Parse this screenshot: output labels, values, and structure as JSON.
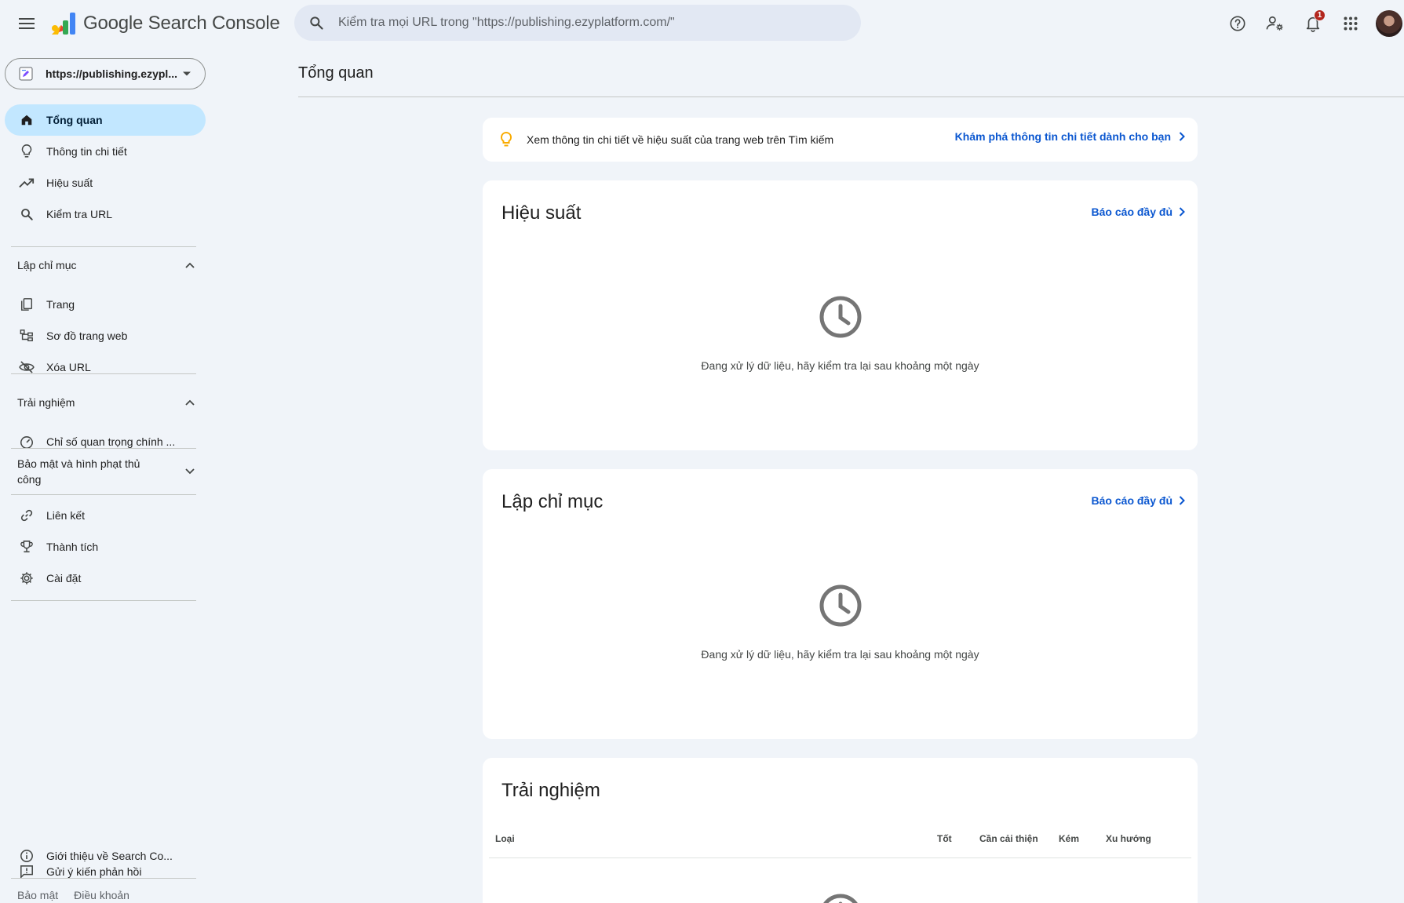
{
  "app": {
    "title": "Google Search Console"
  },
  "search": {
    "placeholder": "Kiểm tra mọi URL trong \"https://publishing.ezyplatform.com/\""
  },
  "header": {
    "notification_count": "1"
  },
  "property": {
    "label": "https://publishing.ezypl..."
  },
  "sidebar": {
    "top_items": [
      {
        "label": "Tổng quan",
        "icon": "home-icon",
        "active": true
      },
      {
        "label": "Thông tin chi tiết",
        "icon": "lightbulb-icon"
      },
      {
        "label": "Hiệu suất",
        "icon": "trending-up-icon"
      },
      {
        "label": "Kiểm tra URL",
        "icon": "search-icon"
      }
    ],
    "indexing": {
      "header": "Lập chỉ mục",
      "items": [
        {
          "label": "Trang",
          "icon": "pages-icon"
        },
        {
          "label": "Sơ đồ trang web",
          "icon": "sitemap-icon"
        },
        {
          "label": "Xóa URL",
          "icon": "visibility-off-icon"
        }
      ]
    },
    "experience": {
      "header": "Trải nghiệm",
      "items": [
        {
          "label": "Chỉ số quan trọng chính ...",
          "icon": "speed-icon"
        }
      ]
    },
    "security": {
      "header": "Bảo mật và hình phạt thủ công"
    },
    "other_items": [
      {
        "label": "Liên kết",
        "icon": "link-icon"
      },
      {
        "label": "Thành tích",
        "icon": "trophy-icon"
      },
      {
        "label": "Cài đặt",
        "icon": "settings-icon"
      }
    ],
    "bottom_items": [
      {
        "label": "Gửi ý kiến phản hồi",
        "icon": "feedback-icon"
      },
      {
        "label": "Giới thiệu về Search Co...",
        "icon": "info-icon"
      }
    ],
    "footer": {
      "privacy": "Bảo mật",
      "terms": "Điều khoản"
    }
  },
  "main": {
    "page_title": "Tổng quan",
    "insight": {
      "text": "Xem thông tin chi tiết về hiệu suất của trang web trên Tìm kiếm",
      "link": "Khám phá thông tin chi tiết dành cho bạn"
    },
    "performance": {
      "title": "Hiệu suất",
      "link": "Báo cáo đầy đủ",
      "status": "Đang xử lý dữ liệu, hãy kiểm tra lại sau khoảng một ngày"
    },
    "indexing": {
      "title": "Lập chỉ mục",
      "link": "Báo cáo đầy đủ",
      "status": "Đang xử lý dữ liệu, hãy kiểm tra lại sau khoảng một ngày"
    },
    "experience": {
      "title": "Trải nghiệm",
      "columns": [
        "Loại",
        "Tốt",
        "Cần cải thiện",
        "Kém",
        "Xu hướng"
      ]
    }
  },
  "colors": {
    "background": "#f0f4f9",
    "active_nav": "#c2e7ff",
    "link": "#0b57d0",
    "badge": "#b3261e",
    "bulb": "#f9ab00"
  }
}
